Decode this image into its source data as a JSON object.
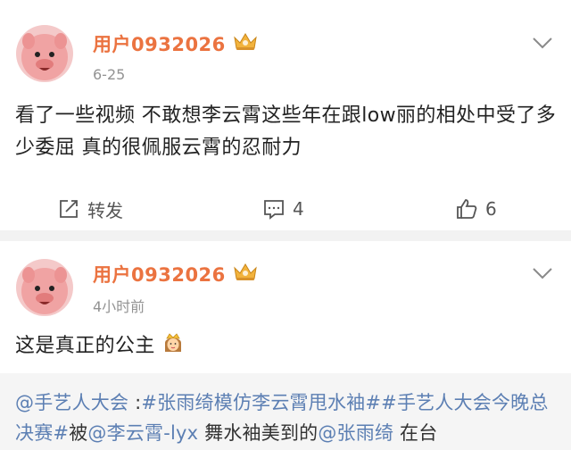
{
  "posts": [
    {
      "username": "用户0932026",
      "timestamp": "6-25",
      "content": "看了一些视频 不敢想李云霄这些年在跟low丽的相处中受了多少委屈 真的很佩服云霄的忍耐力",
      "actions": {
        "repost_label": "转发",
        "comment_count": "4",
        "like_count": "6"
      }
    },
    {
      "username": "用户0932026",
      "timestamp": "4小时前",
      "content": "这是真正的公主"
    }
  ],
  "topic_preview": {
    "mention_1": "@手艺人大会",
    "sep_1": " :",
    "hashtag_1": "#张雨绮模仿李云霄甩水袖#",
    "hashtag_2": "#手艺人大会今晚总决赛#",
    "text_1": "被",
    "mention_2": "@李云霄-lyx",
    "text_2": " 舞水袖美到的",
    "mention_3": "@张雨绮",
    "text_3": " 在台"
  },
  "colors": {
    "username": "#eb7340",
    "link": "#5c7fb3",
    "separator": "#f2f2f2",
    "avatar_pink": "#f0a6a6"
  },
  "icons": [
    "avatar-pig",
    "vip-crown-icon",
    "chevron-down-icon",
    "repost-icon",
    "comment-icon",
    "like-icon",
    "princess-emoji"
  ]
}
